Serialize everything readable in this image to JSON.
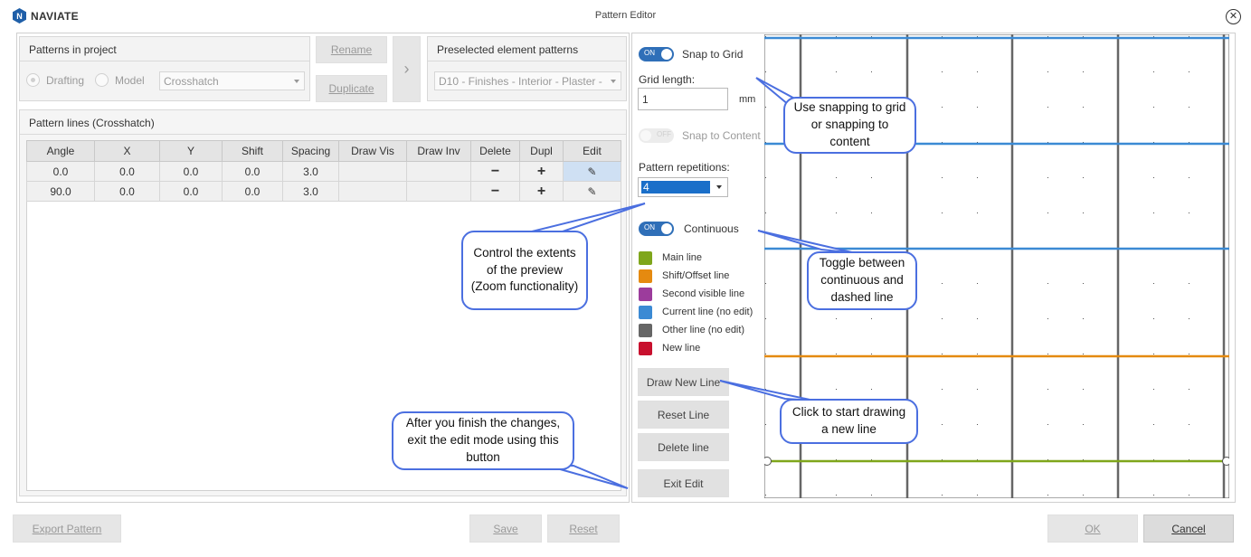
{
  "app": {
    "logo_text": "NAVIATE",
    "logo_glyph": "N",
    "window_title": "Pattern Editor",
    "close_glyph": "✕"
  },
  "patterns_in_project": {
    "header": "Patterns in project",
    "radio_drafting": "Drafting",
    "radio_model": "Model",
    "pattern_select": "Crosshatch",
    "rename_button": "Rename",
    "duplicate_button": "Duplicate",
    "transfer_arrow": "›"
  },
  "preselected": {
    "header": "Preselected element patterns",
    "select_value": "D10 - Finishes - Interior - Plaster -"
  },
  "pattern_lines": {
    "header": "Pattern lines (Crosshatch)",
    "columns": [
      "Angle",
      "X",
      "Y",
      "Shift",
      "Spacing",
      "Draw Vis",
      "Draw Inv",
      "Delete",
      "Dupl",
      "Edit"
    ],
    "rows": [
      {
        "angle": "0.0",
        "x": "0.0",
        "y": "0.0",
        "shift": "0.0",
        "spacing": "3.0",
        "draw_vis": "",
        "draw_inv": "",
        "delete": "−",
        "dupl": "+",
        "edit": "✎"
      },
      {
        "angle": "90.0",
        "x": "0.0",
        "y": "0.0",
        "shift": "0.0",
        "spacing": "3.0",
        "draw_vis": "",
        "draw_inv": "",
        "delete": "−",
        "dupl": "+",
        "edit": "✎"
      }
    ]
  },
  "controls": {
    "snap_grid_toggle": "ON",
    "snap_grid_label": "Snap to Grid",
    "grid_length_label": "Grid length:",
    "grid_length_value": "1",
    "grid_length_unit": "mm",
    "snap_content_toggle": "OFF",
    "snap_content_label": "Snap to Content",
    "repetitions_label": "Pattern repetitions:",
    "repetitions_value": "4",
    "continuous_toggle": "ON",
    "continuous_label": "Continuous"
  },
  "legend": [
    {
      "label": "Main line",
      "color": "#7fa61b"
    },
    {
      "label": "Shift/Offset line",
      "color": "#e58a10"
    },
    {
      "label": "Second visible line",
      "color": "#9c3c9c"
    },
    {
      "label": "Current line (no edit)",
      "color": "#3b8ad4"
    },
    {
      "label": "Other line (no edit)",
      "color": "#666666"
    },
    {
      "label": "New line",
      "color": "#c8102e"
    }
  ],
  "actions": {
    "draw_new_line": "Draw New Line",
    "reset_line": "Reset Line",
    "delete_line": "Delete line",
    "exit_edit": "Exit Edit"
  },
  "footer": {
    "export_pattern": "Export Pattern",
    "save": "Save",
    "reset": "Reset",
    "ok": "OK",
    "cancel": "Cancel"
  },
  "callouts": {
    "snapping": "Use snapping to grid or snapping to content",
    "extents": "Control the extents of the preview (Zoom functionality)",
    "continuous": "Toggle between continuous and dashed line",
    "draw": "Click to start drawing a new line",
    "exit": "After you finish the changes, exit the edit mode using this button"
  },
  "colors": {
    "accent": "#2f6fb8",
    "callout_border": "#4b6fe0",
    "current_line": "#3b8ad4",
    "other_line": "#666666",
    "main_line": "#7fa61b",
    "shift_line": "#e58a10"
  }
}
